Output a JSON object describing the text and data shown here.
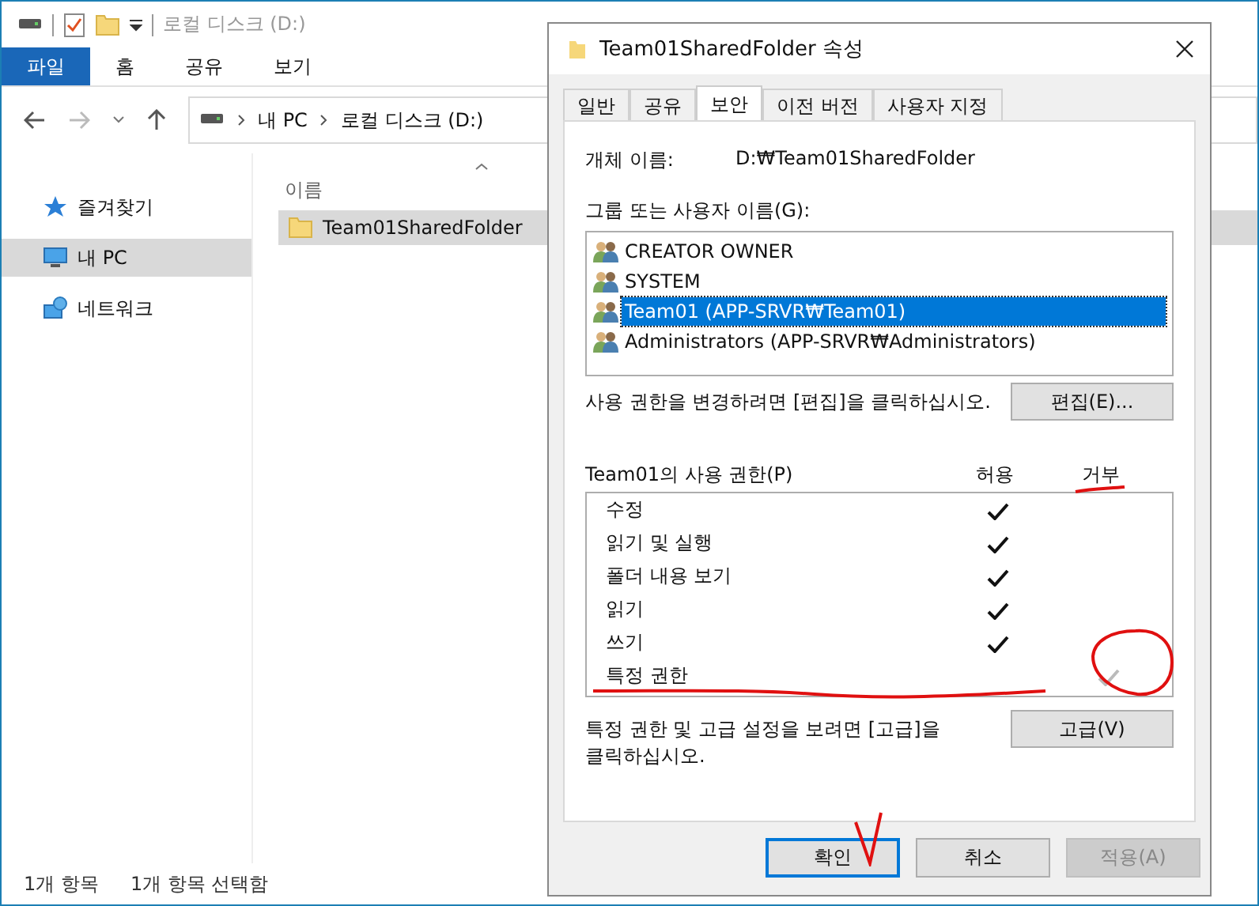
{
  "explorer": {
    "title": "로컬 디스크 (D:)",
    "ribbon_tabs": [
      {
        "label": "파일",
        "selected": true
      },
      {
        "label": "홈",
        "selected": false
      },
      {
        "label": "공유",
        "selected": false
      },
      {
        "label": "보기",
        "selected": false
      }
    ],
    "breadcrumb": [
      "내 PC",
      "로컬 디스크 (D:)"
    ],
    "sidebar": [
      {
        "label": "즐겨찾기",
        "kind": "star",
        "selected": false
      },
      {
        "label": "내 PC",
        "kind": "pc",
        "selected": true
      },
      {
        "label": "네트워크",
        "kind": "network",
        "selected": false
      }
    ],
    "column": "이름",
    "files": [
      {
        "name": "Team01SharedFolder",
        "selected": true
      }
    ],
    "status_bar": [
      "1개 항목",
      "1개 항목 선택함"
    ]
  },
  "dialog": {
    "title": "Team01SharedFolder 속성",
    "tabs": [
      {
        "label": "일반",
        "selected": false
      },
      {
        "label": "공유",
        "selected": false
      },
      {
        "label": "보안",
        "selected": true
      },
      {
        "label": "이전 버전",
        "selected": false
      },
      {
        "label": "사용자 지정",
        "selected": false
      }
    ],
    "object_label": "개체 이름:",
    "object_value": "D:₩Team01SharedFolder",
    "group_label": "그룹 또는 사용자 이름(G):",
    "principals": [
      {
        "name": "CREATOR OWNER",
        "selected": false
      },
      {
        "name": "SYSTEM",
        "selected": false
      },
      {
        "name": "Team01 (APP-SRVR₩Team01)",
        "selected": true
      },
      {
        "name": "Administrators (APP-SRVR₩Administrators)",
        "selected": false
      }
    ],
    "edit_hint": "사용 권한을 변경하려면 [편집]을 클릭하십시오.",
    "edit_button": "편집(E)...",
    "permissions_label": "Team01의 사용 권한(P)",
    "allow_header": "허용",
    "deny_header": {
      "label": "거부",
      "underlined": true
    },
    "permissions": [
      {
        "name": "수정",
        "allow": true,
        "deny": false,
        "greyed": false,
        "underlined": false,
        "circled": false
      },
      {
        "name": "읽기 및 실행",
        "allow": true,
        "deny": false,
        "greyed": false,
        "underlined": false,
        "circled": false
      },
      {
        "name": "폴더 내용 보기",
        "allow": true,
        "deny": false,
        "greyed": false,
        "underlined": false,
        "circled": false
      },
      {
        "name": "읽기",
        "allow": true,
        "deny": false,
        "greyed": false,
        "underlined": false,
        "circled": false
      },
      {
        "name": "쓰기",
        "allow": true,
        "deny": false,
        "greyed": false,
        "underlined": false,
        "circled": false
      },
      {
        "name": "특정 권한",
        "allow": false,
        "deny": true,
        "greyed": true,
        "underlined": true,
        "circled": true
      }
    ],
    "advanced_hint": "특정 권한 및 고급 설정을 보려면 [고급]을 클릭하십시오.",
    "advanced_button": "고급(V)",
    "buttons": [
      {
        "label": "확인",
        "kind": "default",
        "marked": true
      },
      {
        "label": "취소",
        "kind": "normal",
        "marked": false
      },
      {
        "label": "적용(A)",
        "kind": "disabled",
        "marked": false
      }
    ]
  }
}
